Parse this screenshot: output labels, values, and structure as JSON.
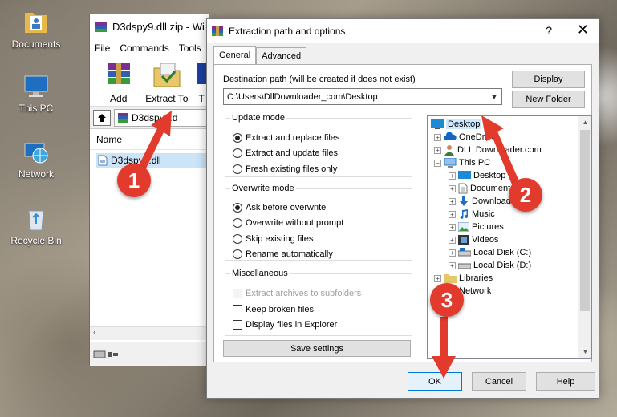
{
  "desktop": {
    "icons": [
      {
        "label": "Documents"
      },
      {
        "label": "This PC"
      },
      {
        "label": "Network"
      },
      {
        "label": "Recycle Bin"
      }
    ]
  },
  "winrar": {
    "title": "D3dspy9.dll.zip - Wi",
    "menu": [
      "File",
      "Commands",
      "Tools"
    ],
    "toolbar": {
      "add_label": "Add",
      "extract_label": "Extract To",
      "partial_label": "T"
    },
    "address": "D3dspy9.d",
    "list_header": "Name",
    "file_name": "D3dspy9.dll"
  },
  "dialog": {
    "title": "Extraction path and options",
    "help_glyph": "?",
    "close_glyph": "✕",
    "tabs": [
      "General",
      "Advanced"
    ],
    "dest_label": "Destination path (will be created if does not exist)",
    "dest_value": "C:\\Users\\DllDownloader_com\\Desktop",
    "display_button": "Display",
    "new_folder_button": "New Folder",
    "update_mode": {
      "legend": "Update mode",
      "options": [
        "Extract and replace files",
        "Extract and update files",
        "Fresh existing files only"
      ],
      "selected": 0
    },
    "overwrite_mode": {
      "legend": "Overwrite mode",
      "options": [
        "Ask before overwrite",
        "Overwrite without prompt",
        "Skip existing files",
        "Rename automatically"
      ],
      "selected": 0
    },
    "misc": {
      "legend": "Miscellaneous",
      "options": [
        "Extract archives to subfolders",
        "Keep broken files",
        "Display files in Explorer"
      ]
    },
    "save_settings_button": "Save settings",
    "tree": [
      {
        "label": "Desktop"
      },
      {
        "label": "OneDrive"
      },
      {
        "label": "DLL Downloader.com"
      },
      {
        "label": "This PC"
      },
      {
        "label": "Desktop"
      },
      {
        "label": "Documents"
      },
      {
        "label": "Downloads"
      },
      {
        "label": "Music"
      },
      {
        "label": "Pictures"
      },
      {
        "label": "Videos"
      },
      {
        "label": "Local Disk (C:)"
      },
      {
        "label": "Local Disk (D:)"
      },
      {
        "label": "Libraries"
      },
      {
        "label": "Network"
      }
    ],
    "ok_button": "OK",
    "cancel_button": "Cancel",
    "help_button": "Help"
  },
  "annotations": [
    {
      "number": "1"
    },
    {
      "number": "2"
    },
    {
      "number": "3"
    }
  ],
  "colors": {
    "annotation_red": "#e23b2d",
    "selection_blue": "#cce8ff",
    "accent": "#0078d7"
  }
}
